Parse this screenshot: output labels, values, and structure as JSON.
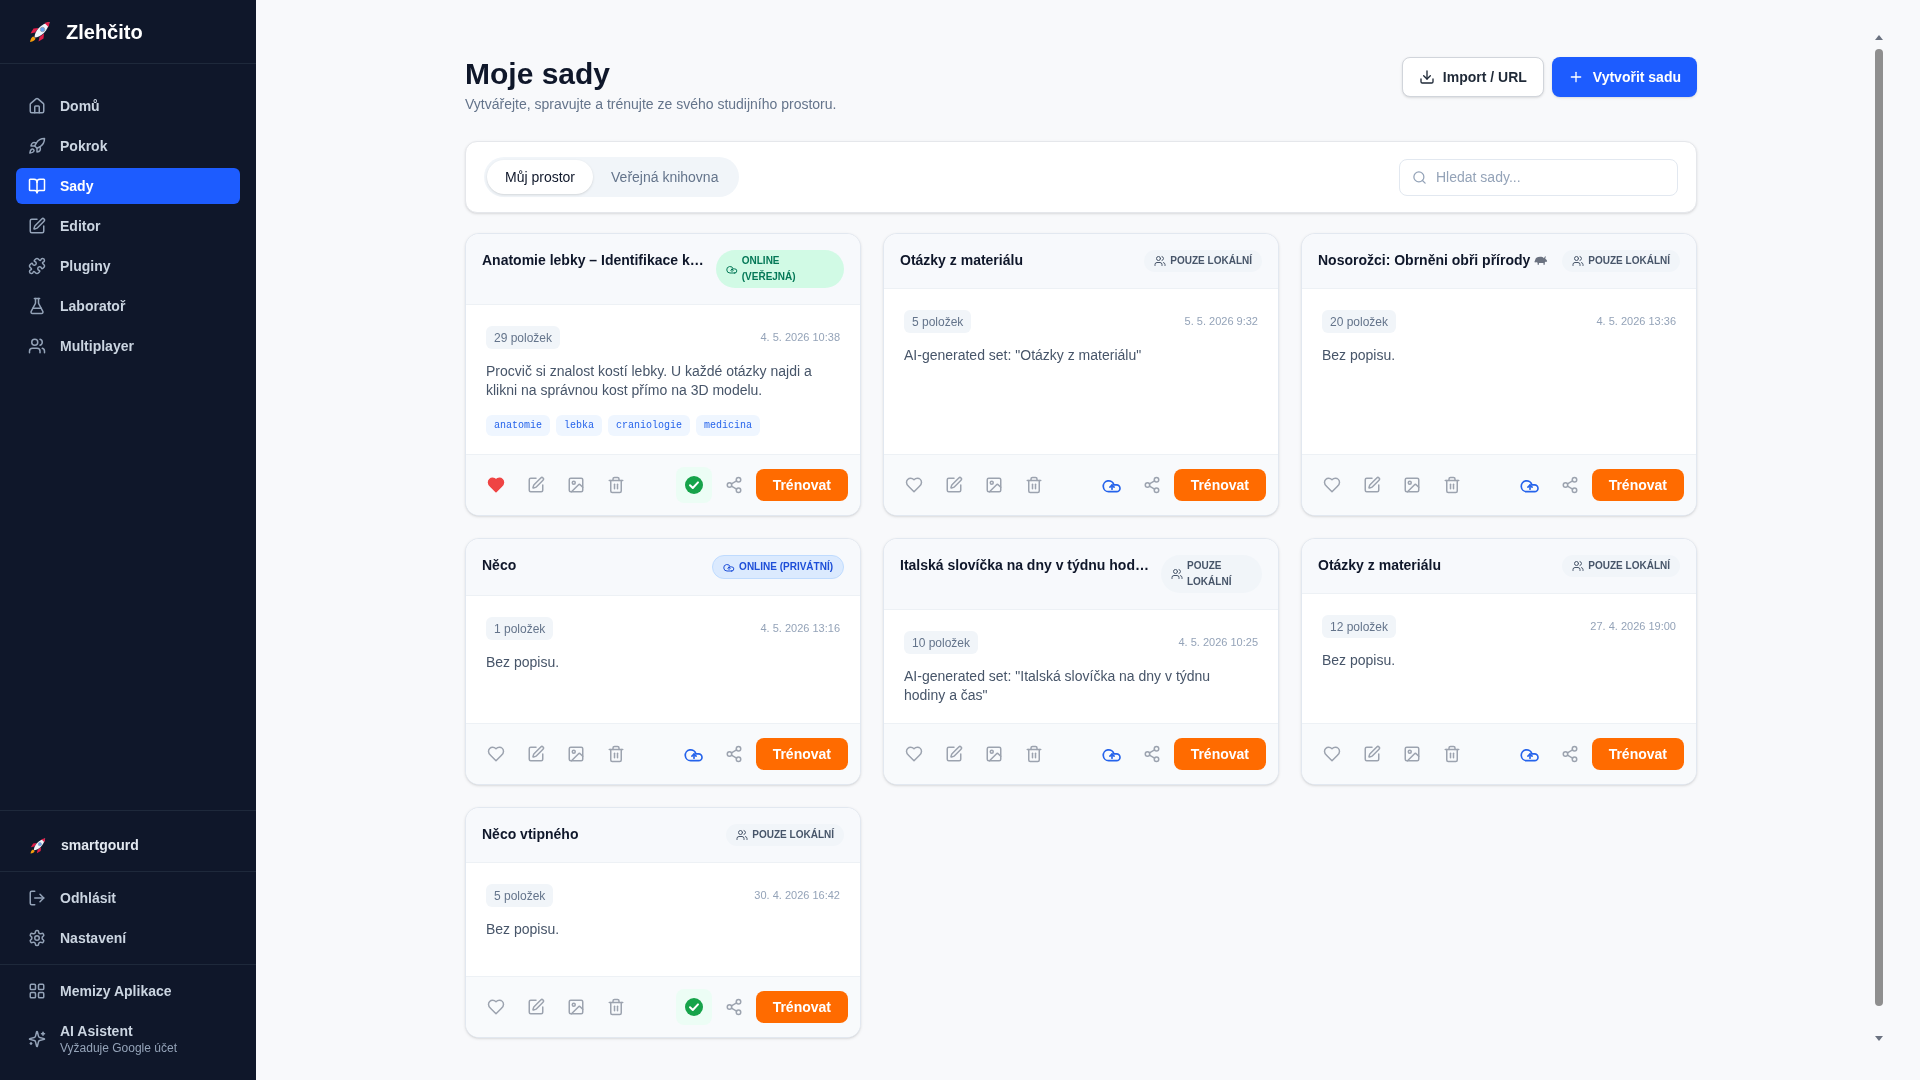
{
  "sidebar": {
    "logo": "Zlehčito",
    "nav": [
      {
        "label": "Domů",
        "selected": false
      },
      {
        "label": "Pokrok",
        "selected": false
      },
      {
        "label": "Sady",
        "selected": true
      },
      {
        "label": "Editor",
        "selected": false
      },
      {
        "label": "Pluginy",
        "selected": false
      },
      {
        "label": "Laboratoř",
        "selected": false
      },
      {
        "label": "Multiplayer",
        "selected": false
      }
    ],
    "user": "smartgourd",
    "account": [
      {
        "label": "Odhlásit"
      },
      {
        "label": "Nastavení"
      }
    ],
    "extras": [
      {
        "label": "Memizy Aplikace"
      },
      {
        "label": "AI Asistent",
        "subtitle": "Vyžaduje Google účet"
      }
    ]
  },
  "header": {
    "title": "Moje sady",
    "subtitle": "Vytvářejte, spravujte a trénujte ze svého studijního prostoru.",
    "actions": [
      {
        "kind": "secondary",
        "label": "Import / URL"
      },
      {
        "kind": "primary",
        "label": "Vytvořit sadu"
      }
    ]
  },
  "toolbar": {
    "tabs": [
      {
        "label": "Můj prostor",
        "selected": true
      },
      {
        "label": "Veřejná knihovna",
        "selected": false
      }
    ],
    "search": {
      "placeholder": "Hledat sady..."
    }
  },
  "cards": [
    {
      "title": "Anatomie lebky – Identifikace k…",
      "has_emoji": false,
      "badge": {
        "kind": "public",
        "text": "ONLINE (VEŘEJNÁ)"
      },
      "count": "29 položek",
      "date": "4. 5. 2026 10:38",
      "description": "Procvič si znalost kostí lebky. U každé otázky najdi a klikni na správnou kost přímo na 3D modelu.",
      "tags": [
        "anatomie",
        "lebka",
        "craniologie",
        "medicina"
      ],
      "favorite": true,
      "synced": true,
      "action": "Trénovat"
    },
    {
      "title": "Otázky z materiálu",
      "has_emoji": false,
      "badge": {
        "kind": "local",
        "text": "POUZE LOKÁLNÍ"
      },
      "count": "5 položek",
      "date": "5. 5. 2026 9:32",
      "description": "AI-generated set: \"Otázky z materiálu\"",
      "favorite": false,
      "synced": false,
      "action": "Trénovat"
    },
    {
      "title": "Nosorožci: Obrněni obři přírody",
      "has_emoji": true,
      "badge": {
        "kind": "local",
        "text": "POUZE LOKÁLNÍ"
      },
      "count": "20 položek",
      "date": "4. 5. 2026 13:36",
      "description": "Bez popisu.",
      "favorite": false,
      "synced": false,
      "action": "Trénovat"
    },
    {
      "title": "Něco",
      "has_emoji": false,
      "badge": {
        "kind": "private",
        "text": "ONLINE (PRIVÁTNÍ)"
      },
      "count": "1 položek",
      "date": "4. 5. 2026 13:16",
      "description": "Bez popisu.",
      "favorite": false,
      "synced": false,
      "action": "Trénovat"
    },
    {
      "title": "Italská slovíčka na dny v týdnu hod…",
      "has_emoji": false,
      "badge": {
        "kind": "local",
        "text": "POUZE LOKÁLNÍ"
      },
      "count": "10 položek",
      "date": "4. 5. 2026 10:25",
      "description": "AI-generated set: \"Italská slovíčka na dny v týdnu hodiny a čas\"",
      "favorite": false,
      "synced": false,
      "action": "Trénovat"
    },
    {
      "title": "Otázky z materiálu",
      "has_emoji": false,
      "badge": {
        "kind": "local",
        "text": "POUZE LOKÁLNÍ"
      },
      "count": "12 položek",
      "date": "27. 4. 2026 19:00",
      "description": "Bez popisu.",
      "favorite": false,
      "synced": false,
      "action": "Trénovat"
    },
    {
      "title": "Něco vtipného",
      "has_emoji": false,
      "badge": {
        "kind": "local",
        "text": "POUZE LOKÁLNÍ"
      },
      "count": "5 položek",
      "date": "30. 4. 2026 16:42",
      "description": "Bez popisu.",
      "favorite": false,
      "synced": true,
      "action": "Trénovat"
    }
  ]
}
